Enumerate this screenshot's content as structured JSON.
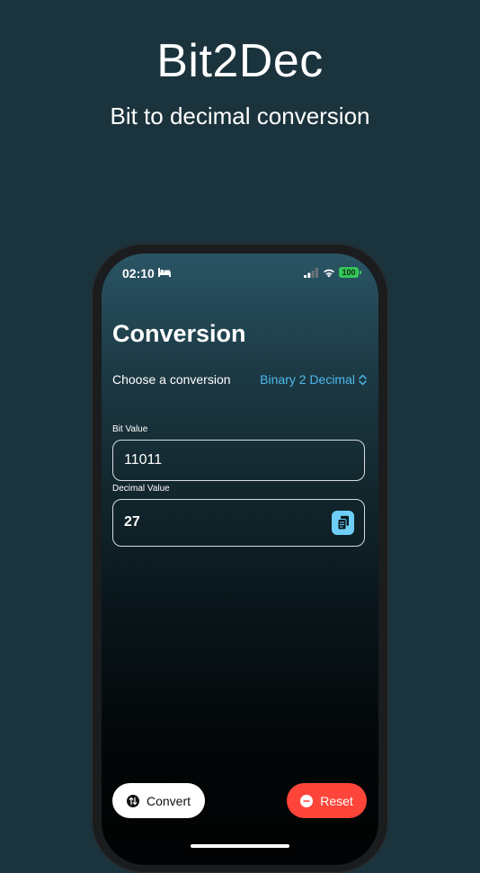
{
  "promo": {
    "title": "Bit2Dec",
    "subtitle": "Bit to decimal conversion"
  },
  "status_bar": {
    "time": "02:10",
    "battery": "100",
    "icons": [
      "bed-icon",
      "cellular-signal-icon",
      "wifi-icon",
      "battery-icon"
    ]
  },
  "screen": {
    "title": "Conversion",
    "choose_label": "Choose a conversion",
    "picker_value": "Binary 2 Decimal",
    "bit_label": "Bit Value",
    "bit_value": "11011",
    "decimal_label": "Decimal Value",
    "decimal_value": "27"
  },
  "actions": {
    "convert_label": "Convert",
    "reset_label": "Reset"
  },
  "colors": {
    "background": "#1b333c",
    "accent": "#4fb9ec",
    "copy_button": "#6ecef7",
    "reset": "#ff453a",
    "battery": "#34c759"
  }
}
